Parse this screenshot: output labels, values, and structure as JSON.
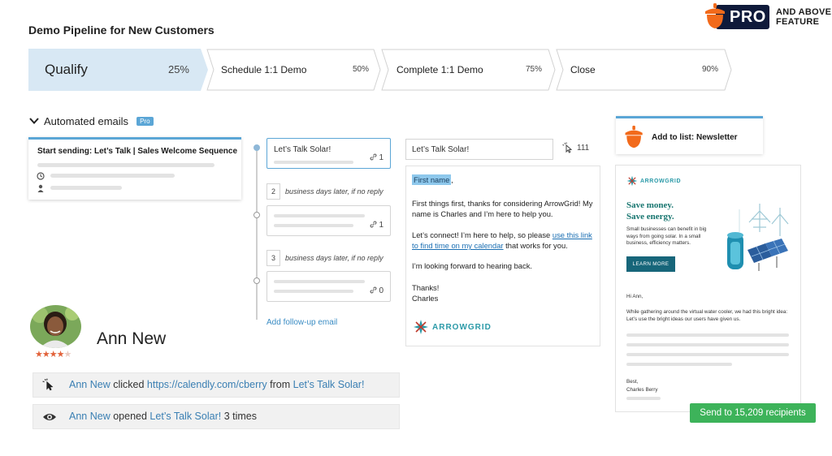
{
  "header": {
    "title": "Demo Pipeline for New Customers",
    "pro_badge": "PRO",
    "above_line1": "AND ABOVE",
    "above_line2": "FEATURE"
  },
  "pipeline": {
    "stages": [
      {
        "label": "Qualify",
        "percent": "25%",
        "active": true
      },
      {
        "label": "Schedule 1:1 Demo",
        "percent": "50%",
        "active": false
      },
      {
        "label": "Complete 1:1 Demo",
        "percent": "75%",
        "active": false
      },
      {
        "label": "Close",
        "percent": "90%",
        "active": false
      }
    ]
  },
  "automated_emails": {
    "label": "Automated emails",
    "pro_tag": "Pro",
    "sequence_title": "Start sending: Let’s Talk | Sales Welcome Sequence"
  },
  "timeline": {
    "emails": [
      {
        "title": "Let’s Talk Solar!",
        "count": "1"
      },
      {
        "title": "",
        "count": "1"
      },
      {
        "title": "",
        "count": "0"
      }
    ],
    "delays": [
      {
        "num": "2",
        "text": "business days later, if no reply"
      },
      {
        "num": "3",
        "text": "business days later, if no reply"
      }
    ],
    "add_followup": "Add follow-up email"
  },
  "editor": {
    "subject": "Let’s Talk Solar!",
    "clicks": "111",
    "token": "First name",
    "token_suffix": ",",
    "para1": "First things first, thanks for considering ArrowGrid! My name is Charles and I’m here to help you.",
    "para2_a": "Let’s connect! I’m here to help, so please ",
    "para2_link": "use this link to find time on my calendar",
    "para2_b": " that works for you.",
    "para3": "I’m looking forward to hearing back.",
    "thanks": "Thanks!",
    "signature": "Charles",
    "brand": "ARROWGRID"
  },
  "newsletter": {
    "list_label": "Add to list: Newsletter",
    "brand": "ARROWGRID",
    "headline1": "Save money.",
    "headline2": "Save energy.",
    "body": "Small businesses can benefit in big ways from going solar. In a small business, efficiency matters.",
    "cta": "LEARN MORE",
    "greeting": "Hi Ann,",
    "paragraph": "While gathering around the virtual water cooler, we had this bright idea: Let’s use the bright ideas our users have given us.",
    "signoff": "Best,",
    "sender": "Charles Berry",
    "send_button": "Send to 15,209 recipients"
  },
  "contact": {
    "name": "Ann New",
    "rating_filled": 4,
    "rating_total": 5,
    "activity_click": {
      "who": "Ann New",
      "verb": "clicked",
      "url": "https://calendly.com/cberry",
      "from": "from",
      "campaign": "Let’s Talk Solar!"
    },
    "activity_open": {
      "who": "Ann New",
      "verb": "opened",
      "campaign": "Let’s Talk Solar!",
      "times": "3 times"
    }
  },
  "colors": {
    "accent_blue": "#5ba6d6",
    "active_stage": "#d8e8f4",
    "send_green": "#3db35a",
    "acorn_orange": "#f26a1b",
    "pro_navy": "#0f1a3a"
  }
}
